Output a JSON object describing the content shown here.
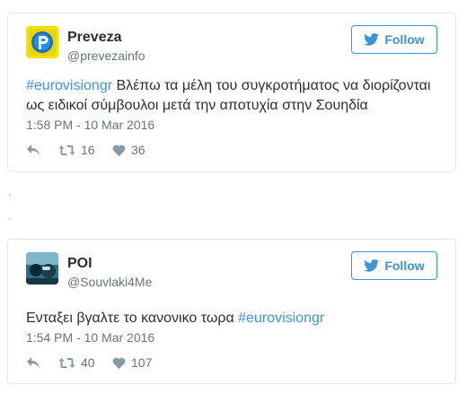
{
  "tweets": [
    {
      "display_name": "Preveza",
      "handle": "@prevezainfo",
      "follow_label": "Follow",
      "hashtag": "#eurovisiongr",
      "text": " Βλέπω τα μέλη του συγκροτήματος να διορίζονται ως ειδικοί σύμβουλοι μετά την αποτυχία στην Σουηδία",
      "timestamp": "1:58 PM - 10 Mar 2016",
      "retweets": "16",
      "likes": "36"
    },
    {
      "display_name": "POI",
      "handle": "@Souvlaki4Me",
      "follow_label": "Follow",
      "text": "Ενταξει βγαλτε το κανονικο τωρα ",
      "hashtag": "#eurovisiongr",
      "timestamp": "1:54 PM - 10 Mar 2016",
      "retweets": "40",
      "likes": "107"
    }
  ],
  "colors": {
    "link_blue": "#3b94d9",
    "meta_gray": "#66757f",
    "icon_gray": "#8899a6",
    "border": "#e1e8ed"
  },
  "icons": {
    "follow": "twitter-bird-icon",
    "reply": "reply-icon",
    "retweet": "retweet-icon",
    "like": "heart-icon"
  }
}
